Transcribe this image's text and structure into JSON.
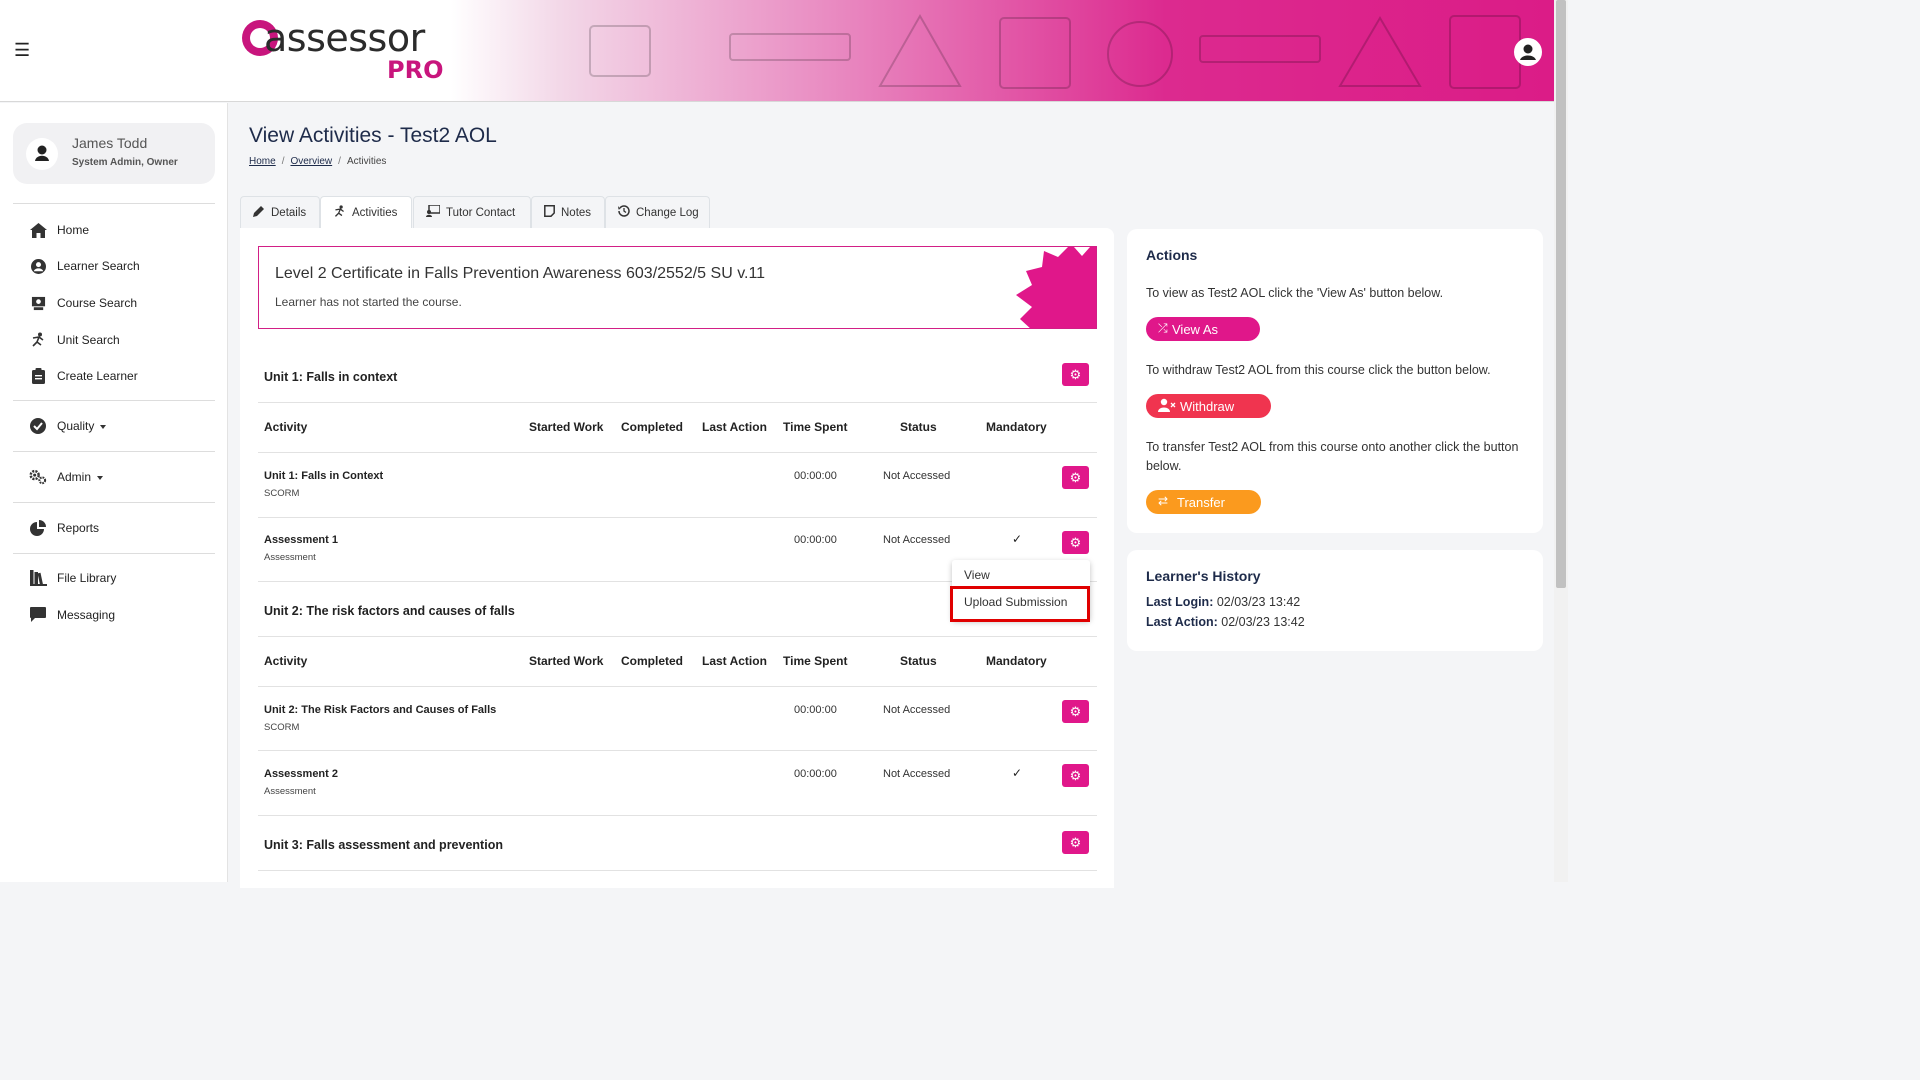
{
  "header": {
    "logo_word": "assessor",
    "logo_sub": "PRO",
    "menu_icon": "hamburger-icon",
    "user_icon": "user-circle-icon"
  },
  "sidebar": {
    "user_name": "James Todd",
    "user_role": "System Admin, Owner",
    "items": [
      {
        "label": "Home",
        "icon": "home-icon"
      },
      {
        "label": "Learner Search",
        "icon": "user-circle-icon"
      },
      {
        "label": "Course Search",
        "icon": "course-icon"
      },
      {
        "label": "Unit Search",
        "icon": "unit-icon"
      },
      {
        "label": "Create Learner",
        "icon": "clipboard-icon"
      },
      {
        "label": "Quality",
        "icon": "check-circle-icon"
      },
      {
        "label": "Admin",
        "icon": "gears-icon"
      },
      {
        "label": "Reports",
        "icon": "pie-chart-icon"
      },
      {
        "label": "File Library",
        "icon": "books-icon"
      },
      {
        "label": "Messaging",
        "icon": "message-icon"
      }
    ]
  },
  "page": {
    "title": "View Activities - Test2 AOL",
    "breadcrumb": [
      "Home",
      "Overview",
      "Activities"
    ]
  },
  "tabs": [
    {
      "label": "Details",
      "icon": "pencil-icon"
    },
    {
      "label": "Activities",
      "icon": "running-icon"
    },
    {
      "label": "Tutor Contact",
      "icon": "tutor-icon"
    },
    {
      "label": "Notes",
      "icon": "note-icon"
    },
    {
      "label": "Change Log",
      "icon": "history-icon"
    }
  ],
  "course": {
    "title": "Level 2 Certificate in Falls Prevention Awareness 603/2552/5 SU v.11",
    "status": "Learner has not started the course."
  },
  "table_headers": [
    "Activity",
    "Started Work",
    "Completed",
    "Last Action",
    "Time Spent",
    "Status",
    "Mandatory"
  ],
  "units": [
    {
      "title": "Unit 1: Falls in context",
      "activities": [
        {
          "name": "Unit 1: Falls in Context",
          "type": "SCORM",
          "time": "00:00:00",
          "status": "Not Accessed",
          "mandatory": ""
        },
        {
          "name": "Assessment 1",
          "type": "Assessment",
          "time": "00:00:00",
          "status": "Not Accessed",
          "mandatory": "✓"
        }
      ]
    },
    {
      "title": "Unit 2: The risk factors and causes of falls",
      "activities": [
        {
          "name": "Unit 2: The Risk Factors and Causes of Falls",
          "type": "SCORM",
          "time": "00:00:00",
          "status": "Not Accessed",
          "mandatory": ""
        },
        {
          "name": "Assessment 2",
          "type": "Assessment",
          "time": "00:00:00",
          "status": "Not Accessed",
          "mandatory": "✓"
        }
      ]
    },
    {
      "title": "Unit 3: Falls assessment and prevention",
      "activities": []
    }
  ],
  "context_menu": {
    "items": [
      "View",
      "Upload Submission"
    ],
    "highlight_color": "#e00000"
  },
  "actions": {
    "title": "Actions",
    "view_as_text": "To view as Test2 AOL click the 'View As' button below.",
    "view_as_label": "View As",
    "withdraw_text": "To withdraw Test2 AOL from this course click the button below.",
    "withdraw_label": "Withdraw",
    "transfer_text": "To transfer Test2 AOL from this course onto another click the button below.",
    "transfer_label": "Transfer"
  },
  "history": {
    "title": "Learner's History",
    "last_login_label": "Last Login:",
    "last_login": "02/03/23 13:42",
    "last_action_label": "Last Action:",
    "last_action": "02/03/23 13:42"
  },
  "colors": {
    "brand": "#e0178a",
    "navy": "#1e2b4a",
    "withdraw": "#f0344f",
    "transfer": "#fb9a1e"
  }
}
